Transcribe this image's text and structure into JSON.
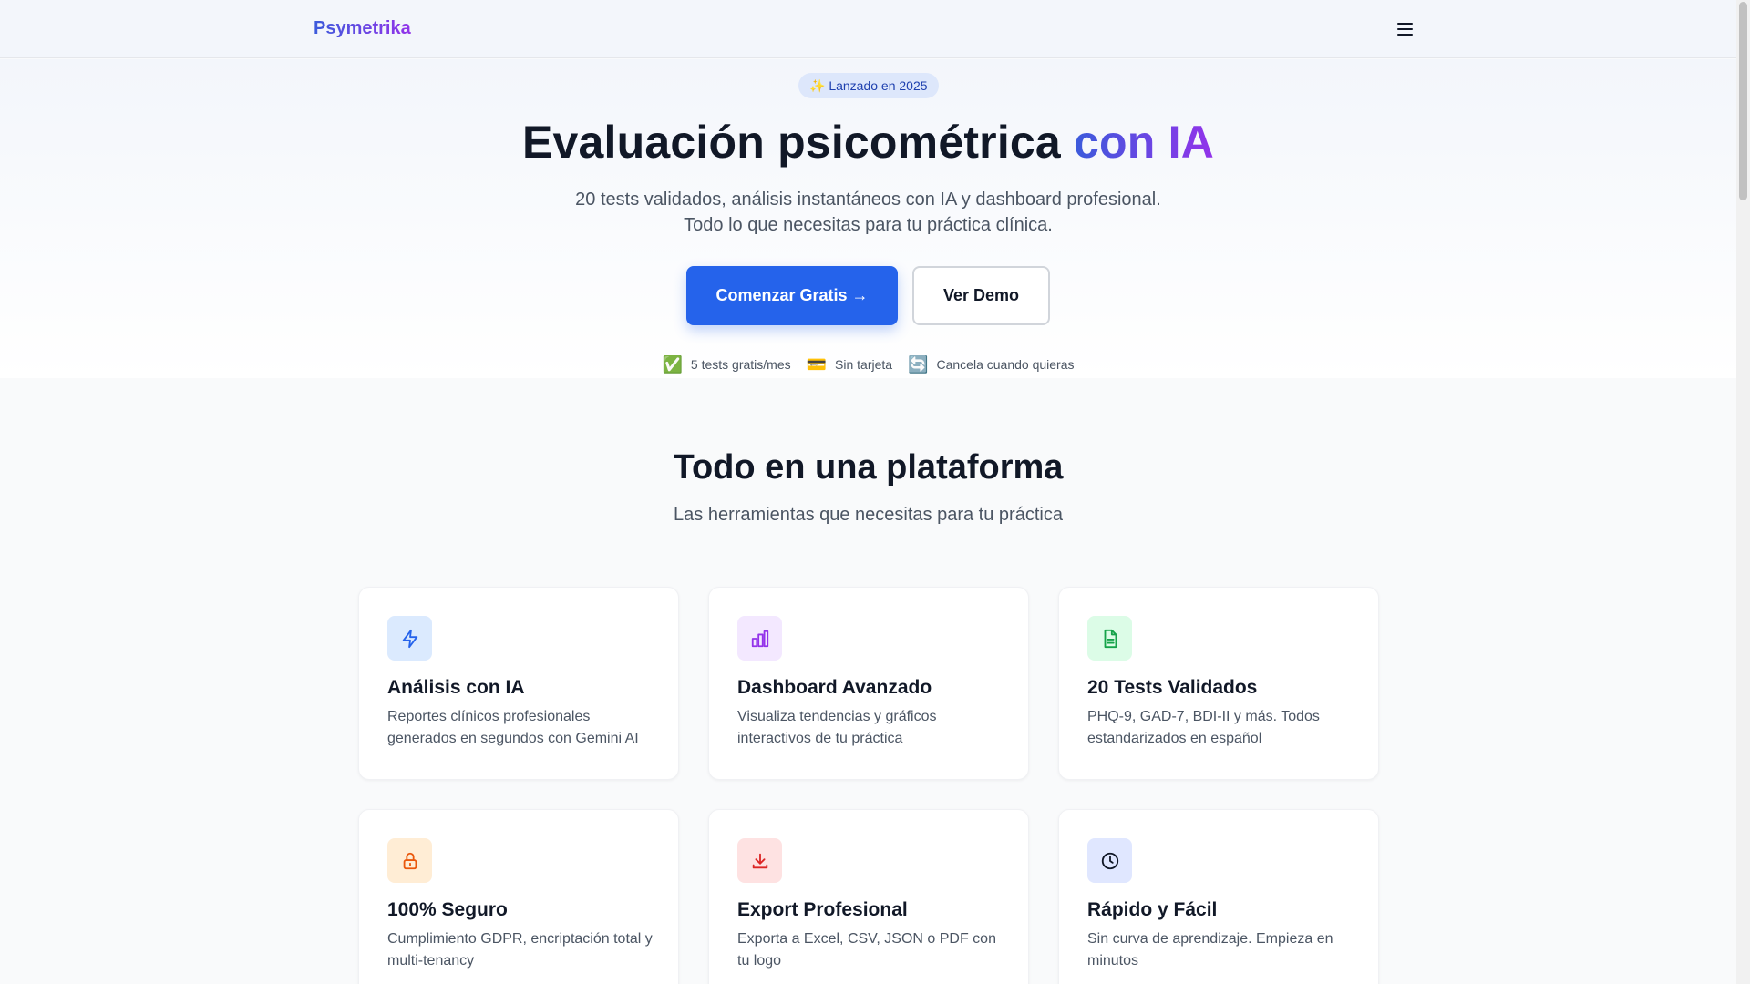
{
  "nav": {
    "brand": "Psymetrika",
    "menu_icon": "menu-icon"
  },
  "hero": {
    "badge": "✨ Lanzado en 2025",
    "title_main": "Evaluación psicométrica ",
    "title_accent": "con IA",
    "subtitle_line1": "20 tests validados, análisis instantáneos con IA y dashboard profesional.",
    "subtitle_line2": "Todo lo que necesitas para tu práctica clínica.",
    "primary_button": "Comenzar Gratis →",
    "secondary_button": "Ver Demo",
    "trust": [
      {
        "icon": "✅",
        "label": "5 tests gratis/mes"
      },
      {
        "icon": "💳",
        "label": "Sin tarjeta"
      },
      {
        "icon": "🔄",
        "label": "Cancela cuando quieras"
      }
    ]
  },
  "features": {
    "title": "Todo en una plataforma",
    "subtitle": "Las herramientas que necesitas para tu práctica",
    "cards": [
      {
        "icon": "lightning-icon",
        "color": "#2563eb",
        "bg": "#dbeafe",
        "title": "Análisis con IA",
        "desc": "Reportes clínicos profesionales generados en segundos con Gemini AI"
      },
      {
        "icon": "bar-chart-icon",
        "color": "#9333ea",
        "bg": "#f3e8ff",
        "title": "Dashboard Avanzado",
        "desc": "Visualiza tendencias y gráficos interactivos de tu práctica"
      },
      {
        "icon": "document-icon",
        "color": "#16a34a",
        "bg": "#dcfce7",
        "title": "20 Tests Validados",
        "desc": "PHQ-9, GAD-7, BDI-II y más. Todos estandarizados en español"
      },
      {
        "icon": "lock-icon",
        "color": "#ea580c",
        "bg": "#ffedd5",
        "title": "100% Seguro",
        "desc": "Cumplimiento GDPR, encriptación total y multi-tenancy"
      },
      {
        "icon": "download-icon",
        "color": "#dc2626",
        "bg": "#fee2e2",
        "title": "Export Profesional",
        "desc": "Exporta a Excel, CSV, JSON o PDF con tu logo"
      },
      {
        "icon": "clock-icon",
        "color": "#111827",
        "bg": "#e0e7ff",
        "title": "Rápido y Fácil",
        "desc": "Sin curva de aprendizaje. Empieza en minutos"
      }
    ]
  }
}
